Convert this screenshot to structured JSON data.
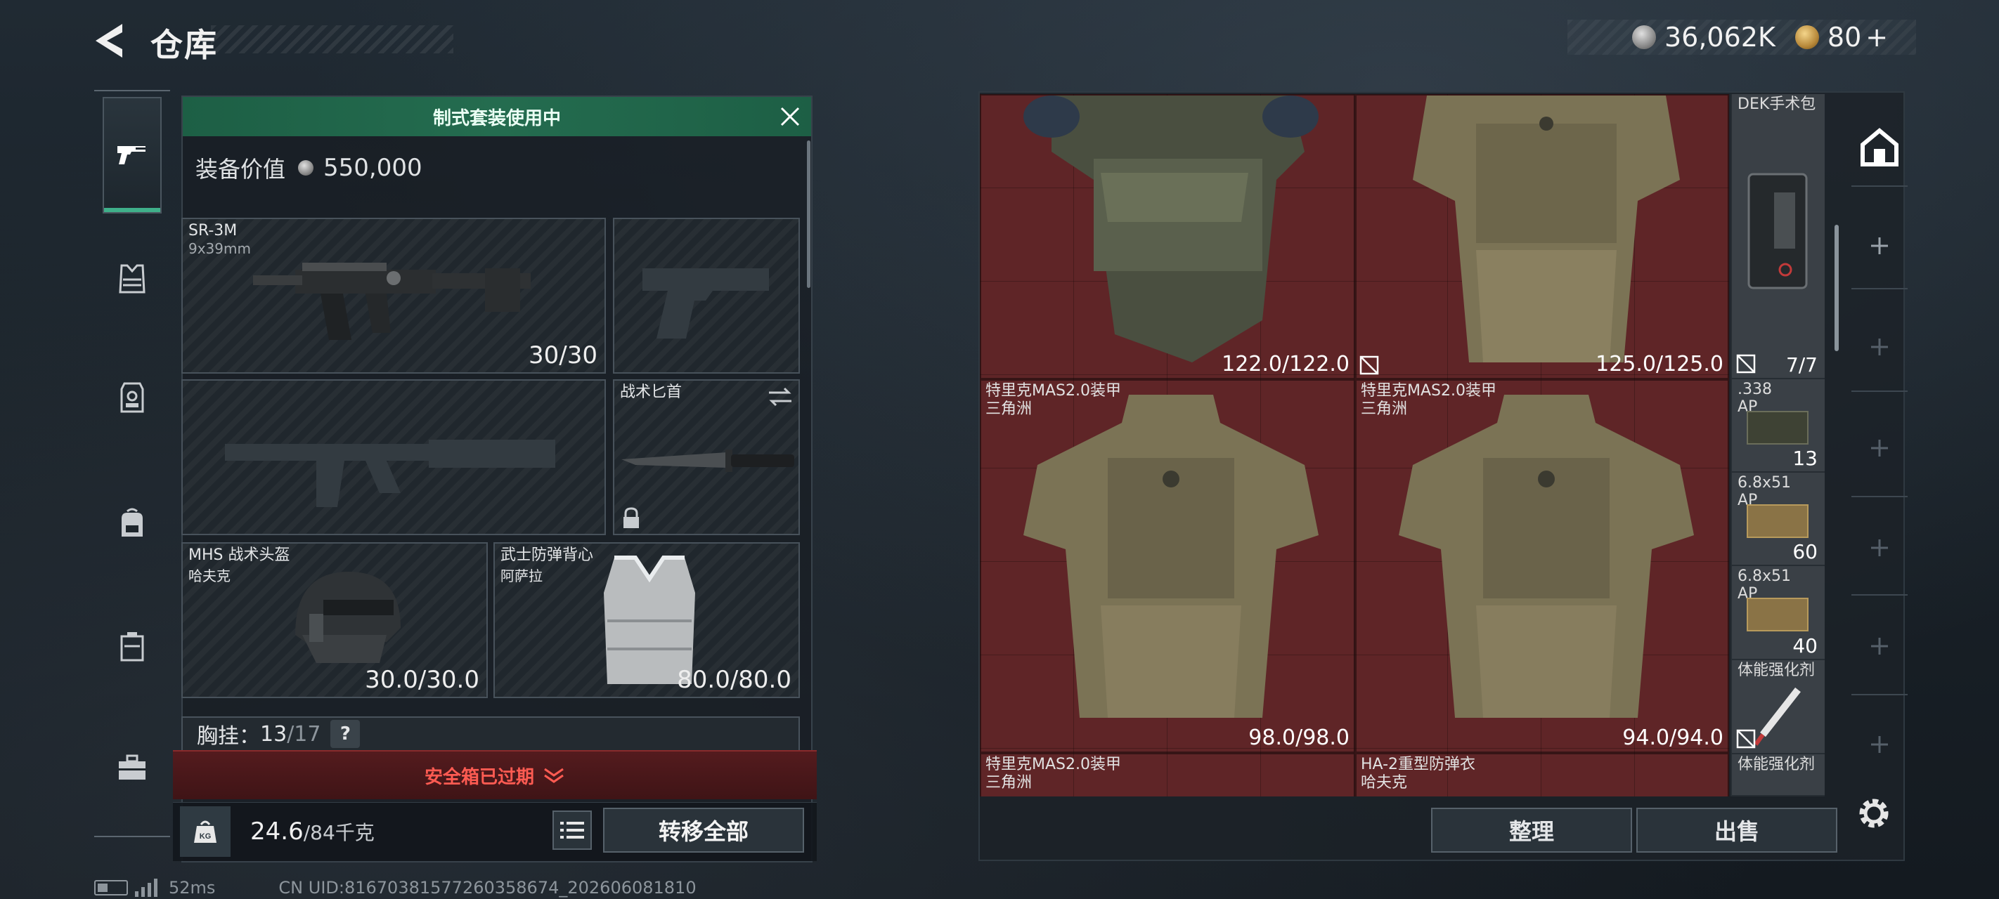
{
  "header": {
    "title": "仓库",
    "silver_currency": "36,062K",
    "gold_currency": "80",
    "gold_add": "+"
  },
  "categories": [
    {
      "icon": "pistol-icon",
      "active": true
    },
    {
      "icon": "vest-icon"
    },
    {
      "icon": "chest-rig-icon"
    },
    {
      "icon": "backpack-icon"
    },
    {
      "icon": "container-icon"
    },
    {
      "icon": "toolbox-icon"
    }
  ],
  "loadout": {
    "banner": "制式套装使用中",
    "equip_value_label": "装备价值",
    "equip_value": "550,000",
    "primary": {
      "name": "SR-3M",
      "caliber": "9x39mm",
      "ammo": "30/30"
    },
    "knife": {
      "name": "战术匕首"
    },
    "helmet": {
      "name": "MHS 战术头盔",
      "faction": "哈夫克",
      "durability": "30.0/30.0"
    },
    "armor": {
      "name": "武士防弹背心",
      "faction": "阿萨拉",
      "durability": "80.0/80.0"
    },
    "chest_rig": {
      "label": "胸挂：",
      "count": "13",
      "capacity": "/17",
      "help": "?"
    },
    "safebox": "安全箱已过期",
    "weight": {
      "current": "24.6",
      "max": "/84千克",
      "icon_label": "KG"
    },
    "transfer_all": "转移全部"
  },
  "storage": {
    "items": [
      {
        "name": "",
        "faction": "",
        "durability": "122.0/122.0"
      },
      {
        "name": "",
        "faction": "",
        "durability": "125.0/125.0"
      },
      {
        "name": "特里克MAS2.0装甲",
        "faction": "三角洲",
        "durability": "98.0/98.0"
      },
      {
        "name": "特里克MAS2.0装甲",
        "faction": "三角洲",
        "durability": "94.0/94.0"
      },
      {
        "name": "特里克MAS2.0装甲",
        "faction": "三角洲",
        "durability": ""
      },
      {
        "name": "HA-2重型防弹衣",
        "faction": "哈夫克",
        "durability": ""
      }
    ],
    "side_items": [
      {
        "name": "DEK手术包",
        "value": "7/7"
      },
      {
        "name": ".338\nAP",
        "value": "13"
      },
      {
        "name": "6.8x51\nAP",
        "value": "60"
      },
      {
        "name": "6.8x51\nAP",
        "value": "40"
      },
      {
        "name": "体能强化剂",
        "value": ""
      },
      {
        "name": "体能强化剂",
        "value": ""
      }
    ],
    "sort_button": "整理",
    "sell_button": "出售"
  },
  "footer": {
    "ping": "52ms",
    "uid": "CN UID:81670381577260358674_202606081810"
  },
  "colors": {
    "accent_green": "#246c4f",
    "storage_bg": "#5f2527",
    "warning_red": "#ff5b52"
  }
}
